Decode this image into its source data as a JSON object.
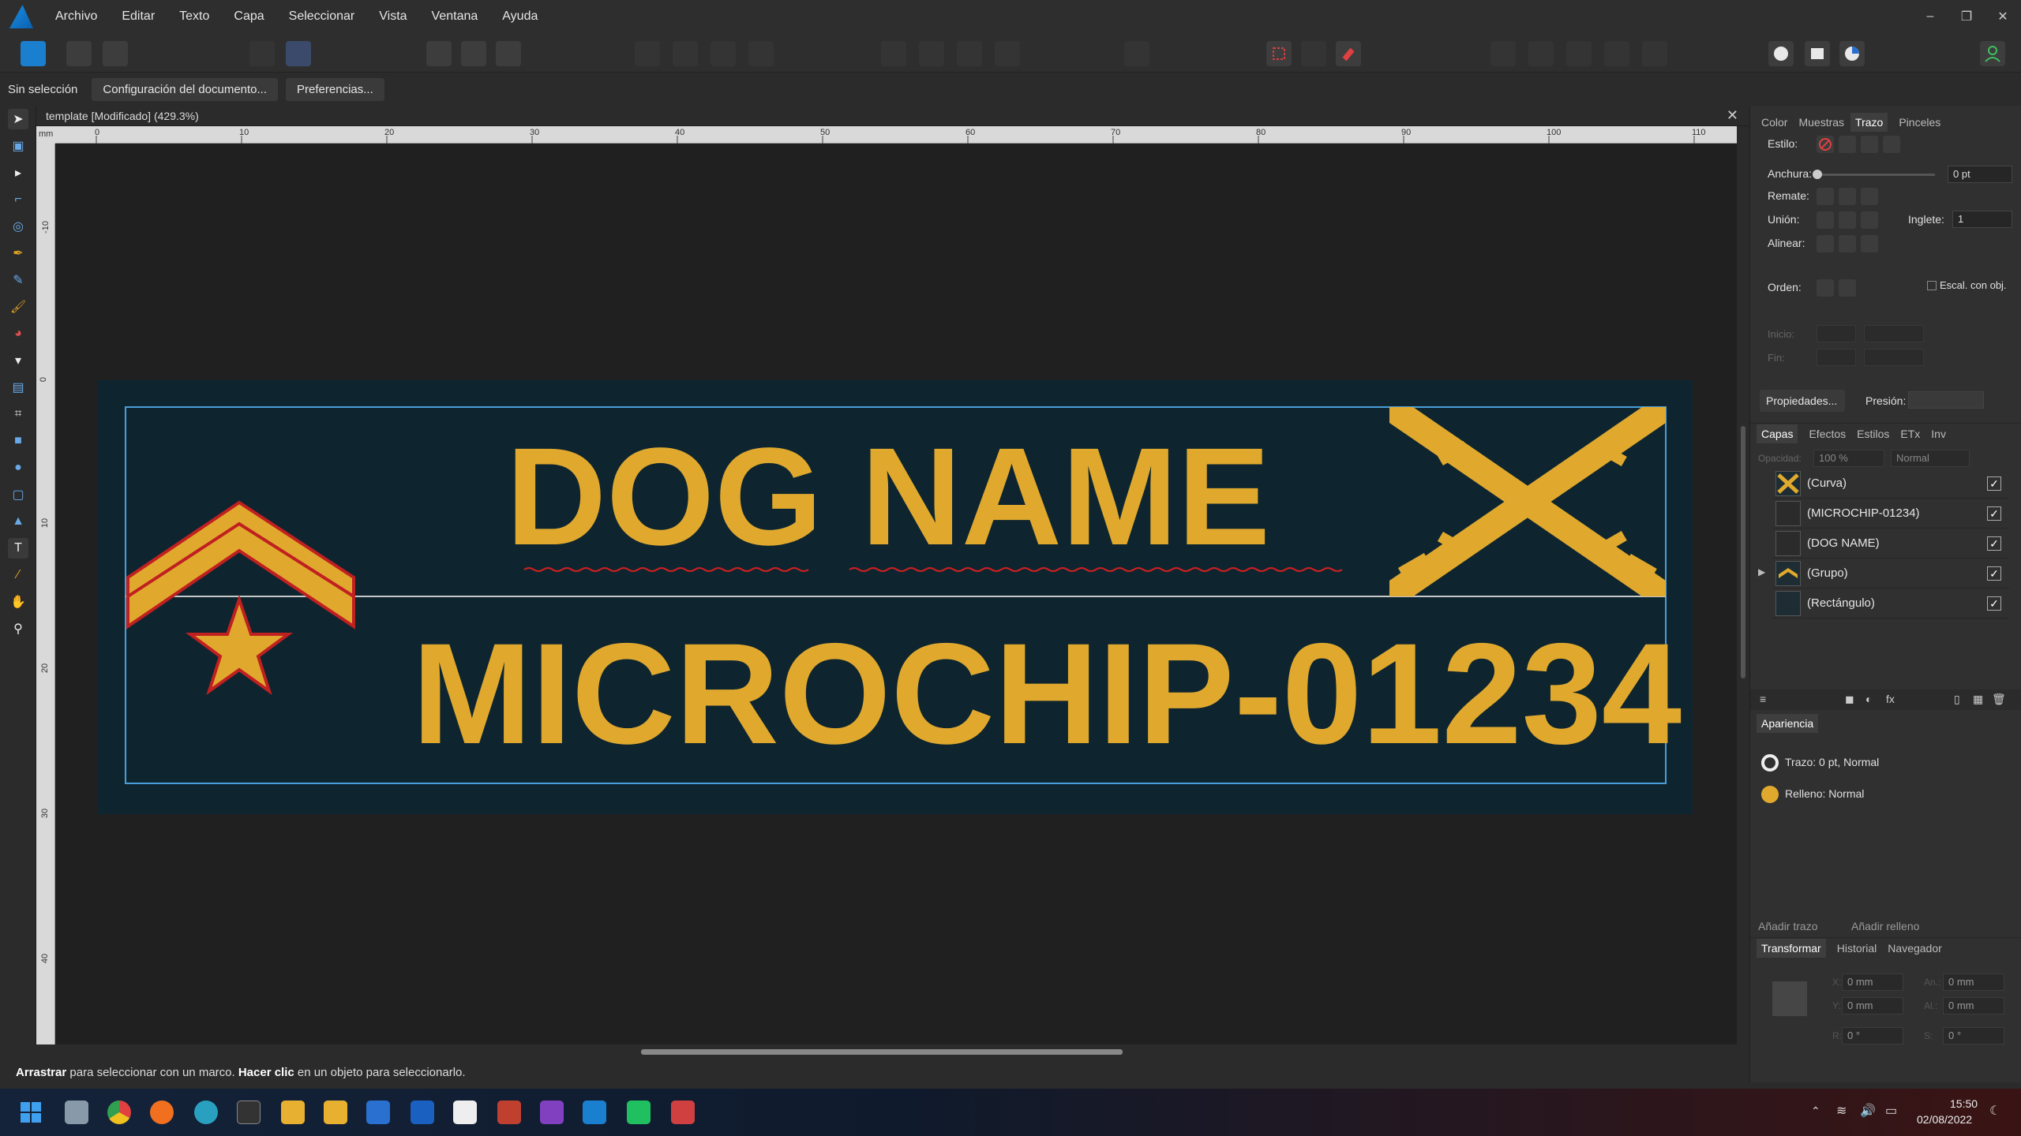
{
  "menu": {
    "items": [
      "Archivo",
      "Editar",
      "Texto",
      "Capa",
      "Seleccionar",
      "Vista",
      "Ventana",
      "Ayuda"
    ]
  },
  "window_controls": {
    "minimize": "–",
    "restore": "❐",
    "close": "✕"
  },
  "context_bar": {
    "selection_label": "Sin selección",
    "doc_setup_button": "Configuración del documento...",
    "preferences_button": "Preferencias..."
  },
  "document": {
    "tab_title": "template [Modificado] (429.3%)",
    "ruler_unit": "mm",
    "h_ticks": [
      "0",
      "10",
      "20",
      "30",
      "40",
      "50",
      "60",
      "70",
      "80",
      "90",
      "100",
      "110"
    ],
    "v_ticks": [
      "-10",
      "0",
      "10",
      "20",
      "30",
      "40"
    ],
    "artwork": {
      "line1": "DOG NAME",
      "line2": "MICROCHIP-01234",
      "bg_color": "#0e2530",
      "text_color": "#e0a92e"
    }
  },
  "status": {
    "drag_bold": "Arrastrar",
    "drag_text": " para seleccionar con un marco. ",
    "click_bold": "Hacer clic",
    "click_text": " en un objeto para seleccionarlo."
  },
  "stroke_panel": {
    "tabs": [
      "Color",
      "Muestras",
      "Trazo",
      "Pinceles"
    ],
    "active_tab": "Trazo",
    "style_label": "Estilo:",
    "width_label": "Anchura:",
    "width_value": "0 pt",
    "cap_label": "Remate:",
    "join_label": "Unión:",
    "miter_label": "Inglete:",
    "miter_value": "1",
    "align_label": "Alinear:",
    "order_label": "Orden:",
    "scale_label": "Escal. con obj.",
    "start_label": "Inicio:",
    "end_label": "Fin:",
    "properties_button": "Propiedades...",
    "pressure_label": "Presión:"
  },
  "layers_panel": {
    "tabs": [
      "Capas",
      "Efectos",
      "Estilos",
      "ETx",
      "Inv"
    ],
    "active_tab": "Capas",
    "opacity_label": "Opacidad:",
    "opacity_value": "100 %",
    "blend_mode": "Normal",
    "layers": [
      {
        "name": "(Curva)",
        "checked": "✓"
      },
      {
        "name": "(MICROCHIP-01234)",
        "checked": "✓"
      },
      {
        "name": "(DOG NAME)",
        "checked": "✓"
      },
      {
        "name": "(Grupo)",
        "checked": "✓"
      },
      {
        "name": "(Rectángulo)",
        "checked": "✓"
      }
    ]
  },
  "appearance_panel": {
    "title": "Apariencia",
    "stroke_entry": "Trazo: 0 pt,  Normal",
    "fill_entry": "Relleno:  Normal",
    "add_stroke": "Añadir trazo",
    "add_fill": "Añadir relleno",
    "fill_color": "#e0a92e"
  },
  "transform_panel": {
    "tabs": [
      "Transformar",
      "Historial",
      "Navegador"
    ],
    "active_tab": "Transformar",
    "x_label": "X:",
    "x_value": "0 mm",
    "y_label": "Y:",
    "y_value": "0 mm",
    "w_label": "An.:",
    "w_value": "0 mm",
    "h_label": "Al.:",
    "h_value": "0 mm",
    "r_label": "R:",
    "r_value": "0 °",
    "s_label": "S:",
    "s_value": "0 °"
  },
  "taskbar": {
    "time": "15:50",
    "date": "02/08/2022"
  }
}
